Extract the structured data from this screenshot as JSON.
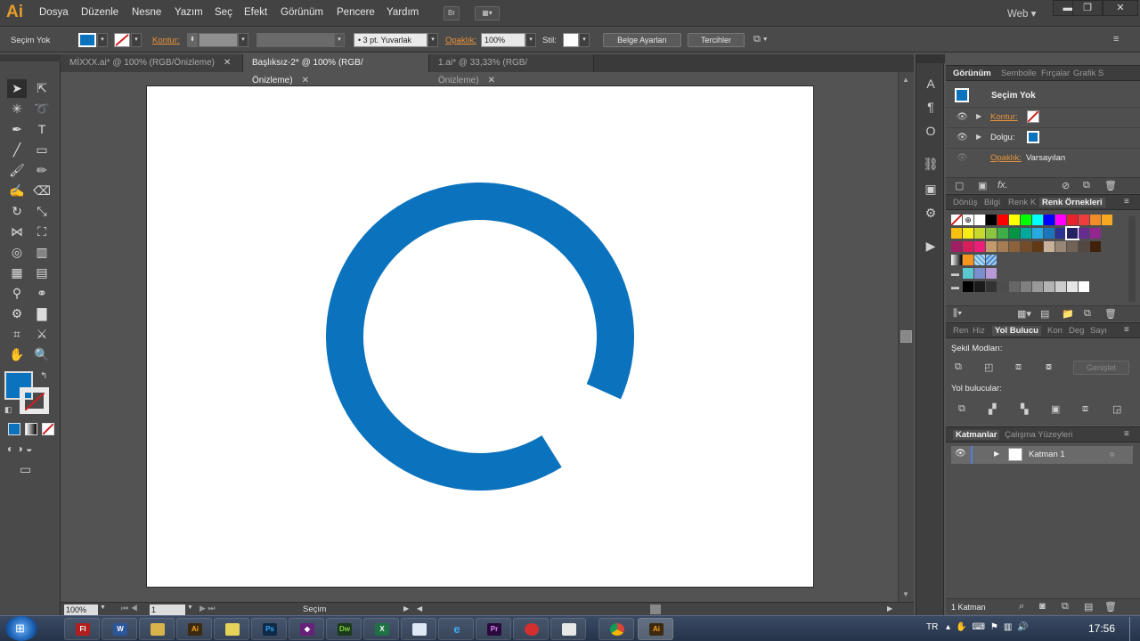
{
  "app": {
    "logo": "Ai",
    "workspace": "Web"
  },
  "menu": [
    "Dosya",
    "Düzenle",
    "Nesne",
    "Yazım",
    "Seç",
    "Efekt",
    "Görünüm",
    "Pencere",
    "Yardım"
  ],
  "menu_buttons": {
    "bridge": "Br"
  },
  "control": {
    "selection": "Seçim Yok",
    "stroke_label": "Kontur:",
    "brush_label": "3 pt. Yuvarlak",
    "opacity_label": "Opaklık:",
    "opacity_value": "100%",
    "style_label": "Stil:",
    "doc_settings": "Belge Ayarları",
    "prefs": "Tercihler"
  },
  "tabs": [
    {
      "label": "MİXXX.ai* @ 100% (RGB/Önizleme)"
    },
    {
      "label": "Başlıksız-2* @ 100% (RGB/Önizleme)"
    },
    {
      "label": "1.ai* @ 33,33% (RGB/Önizleme)"
    }
  ],
  "close_glyph": "✕",
  "status": {
    "zoom": "100%",
    "page": "1",
    "tool": "Seçim"
  },
  "appearance": {
    "tabs": [
      "Görünüm",
      "Sembolle",
      "Fırçalar",
      "Grafik S"
    ],
    "title": "Seçim Yok",
    "stroke": "Kontur:",
    "fill": "Dolgu:",
    "opacity": "Opaklık:",
    "opacity_value": "Varsayılan",
    "fx": "fx."
  },
  "swatches_panel": {
    "tabs": [
      "Dönüş",
      "Bilgi",
      "Renk K",
      "Renk Örnekleri"
    ]
  },
  "pathfinder": {
    "tabs": [
      "Ren",
      "Hiz",
      "Yol Bulucu",
      "Kon",
      "Deg",
      "Sayı"
    ],
    "shape_modes": "Şekil Modları:",
    "expand": "Genişlet",
    "pathfinders": "Yol bulucular:"
  },
  "layers": {
    "tabs": [
      "Katmanlar",
      "Çalışma Yüzeyleri"
    ],
    "layer_name": "Katman 1",
    "footer": "1 Katman"
  },
  "taskbar": {
    "lang": "TR",
    "time": "17:56"
  },
  "colors": {
    "accent_blue": "#0b72bd",
    "ring": "#0b72bd",
    "stroke_swatch_red": "#d02020"
  },
  "swatch_rows": [
    [
      "none",
      "reg",
      "#ffffff",
      "#000000",
      "#ff0000",
      "#ffff00",
      "#00ff00",
      "#00ffff",
      "#0000ff",
      "#ff00ff",
      "#e8232b",
      "#ee3d3d",
      "#f28c28",
      "#f7a823"
    ],
    [
      "#f9c10f",
      "#f6eb14",
      "#c8d92d",
      "#8bc53f",
      "#3fae49",
      "#009444",
      "#00a99d",
      "#27aae1",
      "#1b75bc",
      "#2e3192",
      "#262262",
      "#662d91",
      "#92278f"
    ],
    [
      "#9e1f63",
      "#d91c5c",
      "#ed1e79",
      "#c49a6c",
      "#a67c52",
      "#8b6239",
      "#754c29",
      "#603813",
      "#c7b299",
      "#998675",
      "#736357",
      "#534741",
      "#42210b"
    ],
    [
      "grad1",
      "#f7941d",
      "pat1",
      "pat2"
    ],
    [
      "fold",
      "#5bc8d0",
      "#7b8fcf",
      "#b99ad8"
    ],
    [
      "fold2",
      "#000000",
      "#1a1a1a",
      "#333333",
      "#4d4d4d",
      "#666666",
      "#808080",
      "#999999",
      "#b3b3b3",
      "#cccccc",
      "#e6e6e6",
      "#ffffff"
    ]
  ]
}
